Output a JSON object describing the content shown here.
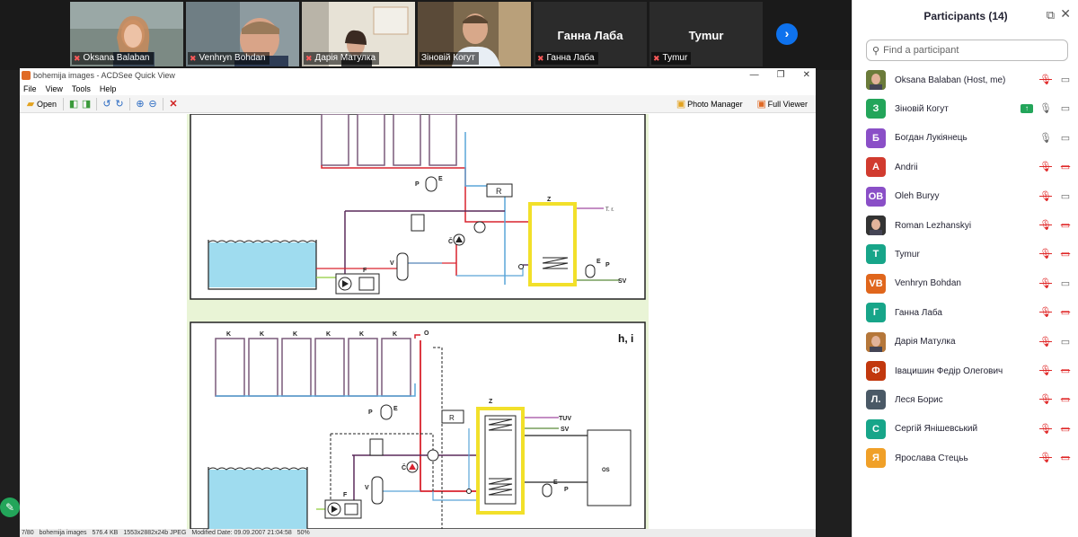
{
  "video_strip": {
    "tiles": [
      {
        "name": "Oksana Balaban"
      },
      {
        "name": "Venhryn Bohdan"
      },
      {
        "name": "Дарія Матулка"
      },
      {
        "name": "Зіновій Когут"
      },
      {
        "name": "Ганна Лаба",
        "big": "Ганна Лаба"
      },
      {
        "name": "Tymur",
        "big": "Tymur"
      }
    ],
    "next_icon": "chevron-right-icon"
  },
  "acdsee": {
    "title": "bohemija images - ACDSee Quick View",
    "menu": [
      "File",
      "View",
      "Tools",
      "Help"
    ],
    "toolbar": {
      "open": "Open",
      "photo_manager": "Photo Manager",
      "full_viewer": "Full Viewer"
    },
    "status": [
      "7/80",
      "bohemija images",
      "576.4 KB",
      "1553x2882x24b JPEG",
      "Modified Date: 09.09.2007 21:04:58",
      "50%"
    ],
    "diagram": {
      "top": {
        "labels": [
          "P",
          "E",
          "R",
          "Z",
          "T. r.",
          "Č",
          "V",
          "F",
          "SV",
          "P",
          "E"
        ]
      },
      "bottom": {
        "section_label": "h, i",
        "collector_labels": [
          "K",
          "K",
          "K",
          "K",
          "K",
          "K"
        ],
        "labels": [
          "O",
          "R",
          "Z",
          "TUV",
          "SV",
          "OS",
          "P",
          "E",
          "Č",
          "V",
          "F",
          "E",
          "P"
        ]
      }
    }
  },
  "participants": {
    "title": "Participants (14)",
    "search_placeholder": "Find a participant",
    "list": [
      {
        "initials": "",
        "name": "Oksana Balaban (Host, me)",
        "color": "#6b7b3a",
        "photo": true,
        "mic": "muted",
        "cam": "on"
      },
      {
        "initials": "З",
        "name": "Зіновій Когут",
        "color": "#23a55a",
        "share": true,
        "mic": "on",
        "cam": "on"
      },
      {
        "initials": "Б",
        "name": "Богдан Лукіянець",
        "color": "#8a4fc7",
        "mic": "on",
        "cam": "on"
      },
      {
        "initials": "A",
        "name": "Andrii",
        "color": "#d13b2f",
        "mic": "muted",
        "cam": "off"
      },
      {
        "initials": "OB",
        "name": "Oleh Buryy",
        "color": "#8a4fc7",
        "mic": "muted",
        "cam": "on"
      },
      {
        "initials": "",
        "name": "Roman Lezhanskyi",
        "color": "#333333",
        "photo": true,
        "mic": "muted",
        "cam": "off"
      },
      {
        "initials": "T",
        "name": "Tymur",
        "color": "#17a589",
        "mic": "muted",
        "cam": "off"
      },
      {
        "initials": "VB",
        "name": "Venhryn Bohdan",
        "color": "#e0661c",
        "mic": "muted",
        "cam": "on"
      },
      {
        "initials": "Г",
        "name": "Ганна Лаба",
        "color": "#17a589",
        "mic": "muted",
        "cam": "off"
      },
      {
        "initials": "",
        "name": "Дарія Матулка",
        "color": "#b5773a",
        "photo": true,
        "mic": "muted",
        "cam": "on"
      },
      {
        "initials": "Ф",
        "name": "Івацишин Федір Олегович",
        "color": "#c2380e",
        "mic": "muted",
        "cam": "off"
      },
      {
        "initials": "Л.",
        "name": "Леся Борис",
        "color": "#4a5966",
        "mic": "muted",
        "cam": "off"
      },
      {
        "initials": "С",
        "name": "Сергій Янішевський",
        "color": "#17a589",
        "mic": "muted",
        "cam": "off"
      },
      {
        "initials": "Я",
        "name": "Ярослава Стецьь",
        "color": "#f0a028",
        "mic": "muted",
        "cam": "off"
      }
    ]
  }
}
